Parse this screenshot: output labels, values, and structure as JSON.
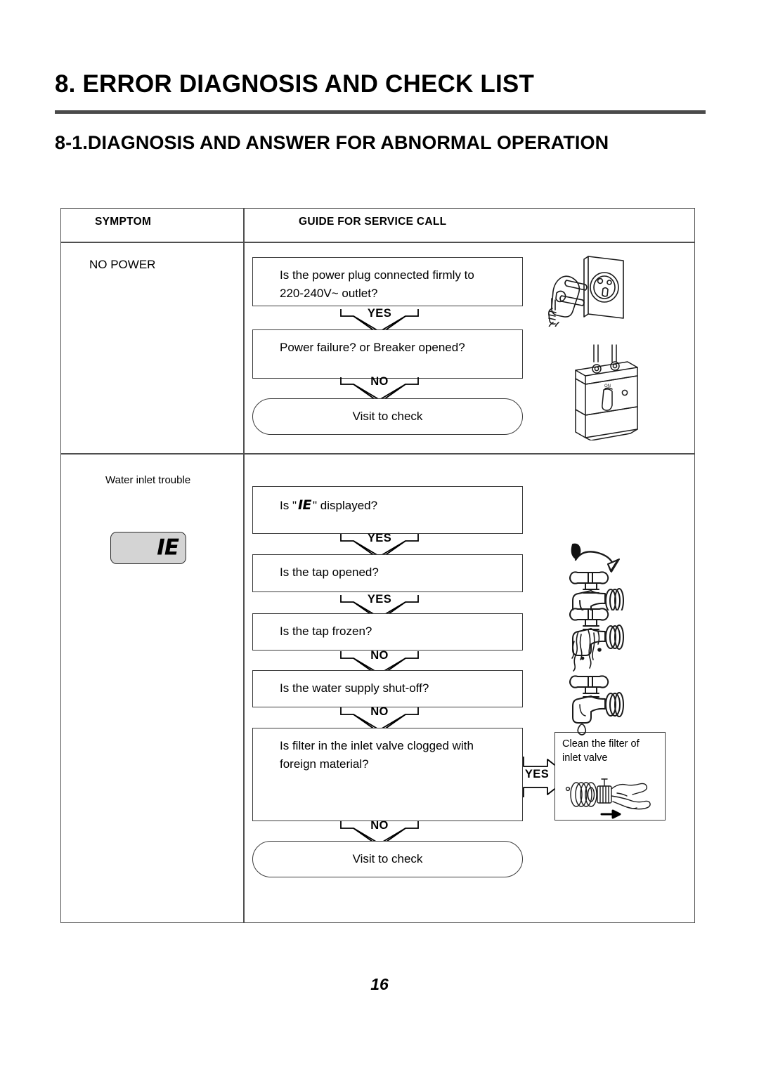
{
  "document": {
    "chapter_title": "8. ERROR DIAGNOSIS AND CHECK LIST",
    "section_title": "8-1.DIAGNOSIS AND ANSWER FOR ABNORMAL OPERATION",
    "page_number": "16"
  },
  "table": {
    "headers": {
      "symptom": "SYMPTOM",
      "guide": "GUIDE FOR SERVICE CALL"
    },
    "rows": [
      {
        "symptom": "NO POWER",
        "steps": [
          "Is the power plug connected firmly to 220-240V~ outlet?",
          "Power failure? or Breaker opened?",
          "Visit to check"
        ],
        "connectors": [
          "YES",
          "NO"
        ],
        "illustrations": [
          "power-plug-outlet",
          "circuit-breaker"
        ]
      },
      {
        "symptom": "Water inlet trouble",
        "error_code": "IE",
        "steps": [
          "Is \" IE \" displayed?",
          "Is the tap opened?",
          "Is the tap frozen?",
          "Is the water supply shut-off?",
          "Is filter in the inlet valve clogged with foreign material?",
          "Visit to check"
        ],
        "connectors": [
          "YES",
          "YES",
          "NO",
          "NO",
          "NO"
        ],
        "branch": {
          "label": "YES",
          "note": "Clean the filter of inlet valve",
          "illustration": "hand-cleaning-filter"
        },
        "illustrations": [
          "tap-open-rotate",
          "tap-frozen-ice",
          "tap-drip-shutoff"
        ]
      }
    ]
  },
  "step_text": {
    "q1_line1": "Is the power plug connected firmly to",
    "q1_line2": "220-240V~ outlet?",
    "q2": "Power failure? or Breaker opened?",
    "q3": "Visit to check",
    "q4_prefix": "Is \"",
    "q4_code": "IE",
    "q4_suffix": "\" displayed?",
    "q5": "Is the tap opened?",
    "q6": "Is the tap frozen?",
    "q7": "Is the water supply shut-off?",
    "q8_line1": "Is filter in the inlet valve clogged with",
    "q8_line2": "foreign material?",
    "q9": "Visit to check",
    "note_line1": "Clean the filter of",
    "note_line2": "inlet valve"
  },
  "connectors": {
    "yes": "YES",
    "no": "NO"
  },
  "colors": {
    "rule": "#4a4a4a",
    "border": "#4f4f4f",
    "box_border": "#3c3c3c",
    "lcd_bg": "#d4d4d4",
    "text": "#000000"
  }
}
